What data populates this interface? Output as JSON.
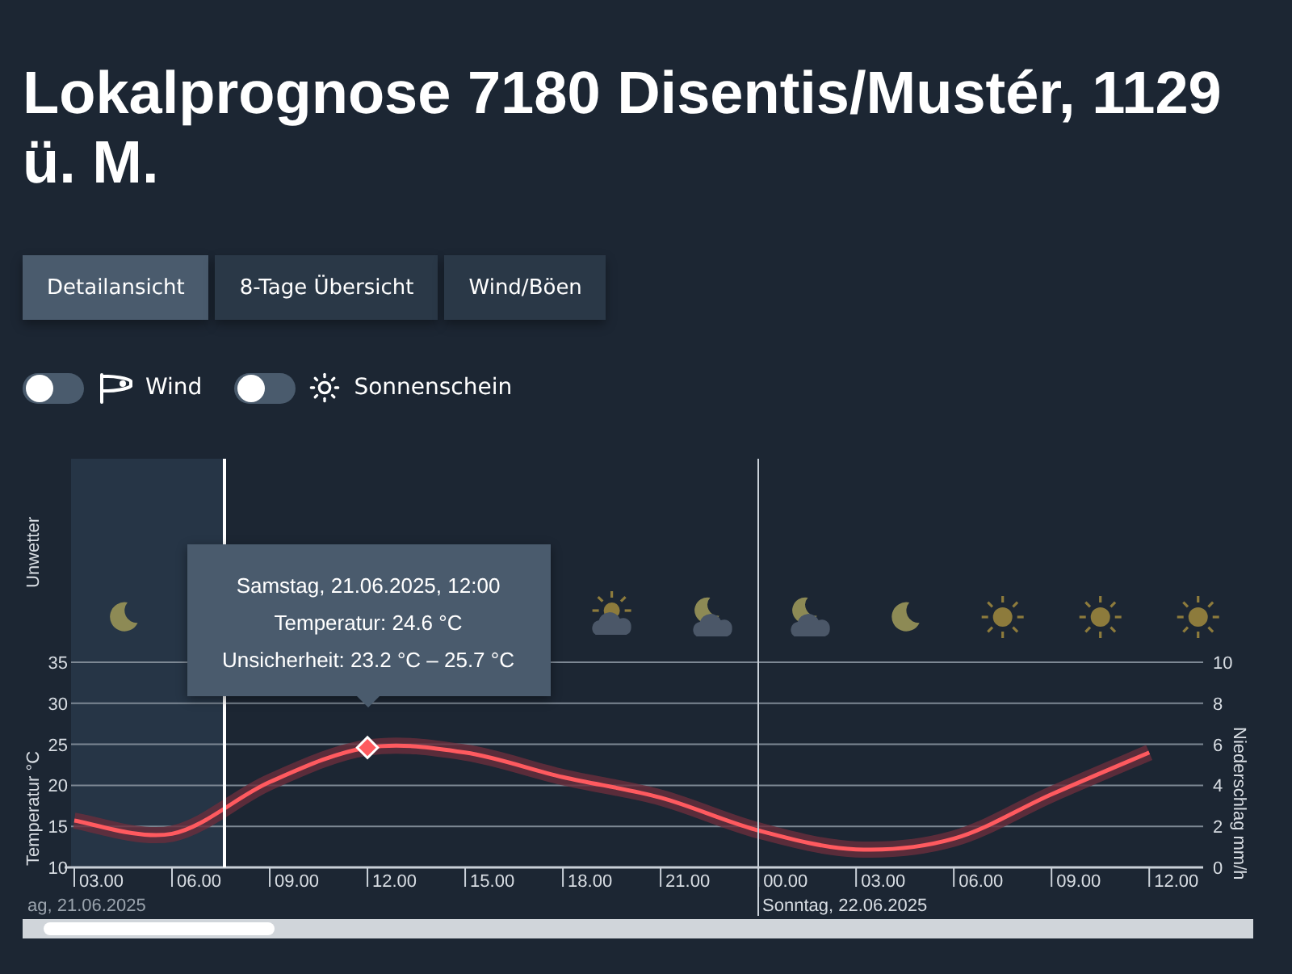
{
  "title_lines": [
    "Lokalprognose 7180 Disentis/Mustér, 1129",
    "ü. M."
  ],
  "tabs": [
    {
      "label": "Detailansicht",
      "selected": true
    },
    {
      "label": "8-Tage Übersicht",
      "selected": false
    },
    {
      "label": "Wind/Böen",
      "selected": false
    }
  ],
  "toggles": [
    {
      "kind": "wind",
      "label": "Wind",
      "on": false
    },
    {
      "kind": "sun",
      "label": "Sonnenschein",
      "on": false
    }
  ],
  "chart": {
    "storm_label": "Unwetter",
    "weather_icons": [
      {
        "kind": "moon"
      },
      {
        "kind": "sun-cloud"
      },
      {
        "kind": "moon-cloud"
      },
      {
        "kind": "moon-cloud"
      },
      {
        "kind": "moon"
      },
      {
        "kind": "sun"
      },
      {
        "kind": "sun"
      },
      {
        "kind": "sun"
      }
    ],
    "chart_data": {
      "type": "line",
      "ylabel": "Temperatur °C",
      "grid": true,
      "categories": [
        "03.00",
        "06.00",
        "09.00",
        "12.00",
        "15.00",
        "18.00",
        "21.00",
        "00.00",
        "03.00",
        "06.00",
        "09.00",
        "12.00"
      ],
      "series": [
        {
          "color": "#ff5a5f",
          "values": [
            15.7,
            14.1,
            20.4,
            24.6,
            24,
            21,
            18.5,
            14.5,
            12.2,
            13.5,
            18.9,
            24
          ]
        }
      ],
      "ylim": [
        10,
        35
      ],
      "yticks": [
        10,
        15,
        20,
        25,
        30,
        35
      ]
    },
    "precip_axis": {
      "label": "Niederschlag mm/h",
      "ticks": [
        "10",
        "8",
        "6",
        "4",
        "2",
        "0"
      ]
    },
    "date_labels": [
      "ag, 21.06.2025",
      "Sonntag, 22.06.2025"
    ],
    "tooltip": {
      "lines": [
        "Samstag, 21.06.2025, 12:00",
        "Temperatur: 24.6 °C",
        "Unsicherheit: 23.2 °C – 25.7 °C"
      ]
    }
  }
}
